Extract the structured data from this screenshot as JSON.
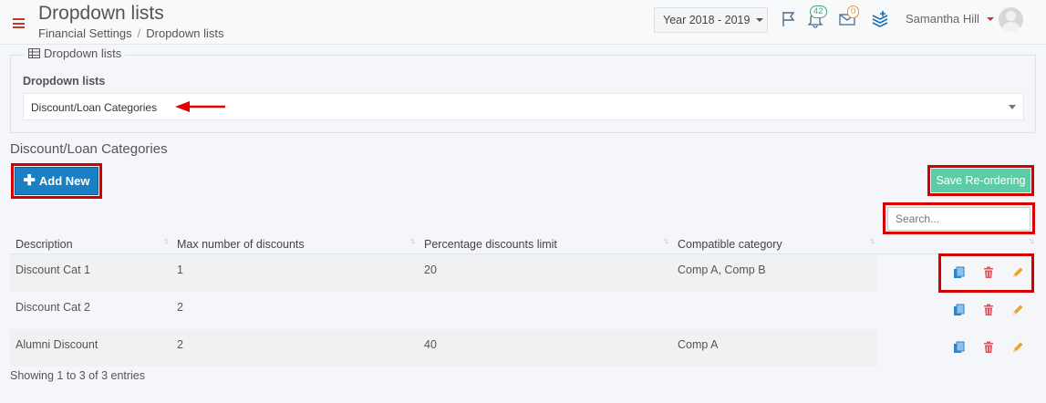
{
  "header": {
    "title": "Dropdown lists",
    "breadcrumb": [
      "Financial Settings",
      "Dropdown lists"
    ],
    "year_select": "Year 2018 - 2019",
    "notifications_count": "42",
    "messages_count": "0",
    "user_name": "Samantha Hill"
  },
  "panel": {
    "legend": "Dropdown lists",
    "label": "Dropdown lists",
    "selected": "Discount/Loan Categories"
  },
  "section_title": "Discount/Loan Categories",
  "toolbar": {
    "add_new_label": "Add New",
    "save_reordering_label": "Save Re-ordering",
    "search_placeholder": "Search..."
  },
  "table": {
    "columns": [
      "Description",
      "Max number of discounts",
      "Percentage discounts limit",
      "Compatible category"
    ],
    "rows": [
      {
        "description": "Discount Cat 1",
        "max": "1",
        "limit": "20",
        "compatible": "Comp A, Comp B"
      },
      {
        "description": "Discount Cat 2",
        "max": "2",
        "limit": "",
        "compatible": ""
      },
      {
        "description": "Alumni Discount",
        "max": "2",
        "limit": "40",
        "compatible": "Comp A"
      }
    ]
  },
  "footer": {
    "info": "Showing 1 to 3 of 3 entries"
  },
  "colors": {
    "primary": "#1a7fc4",
    "save": "#5ecba7",
    "highlight": "#d40000",
    "copy_icon": "#2f84cc",
    "delete_icon": "#e0535b",
    "edit_icon": "#f0a030"
  }
}
